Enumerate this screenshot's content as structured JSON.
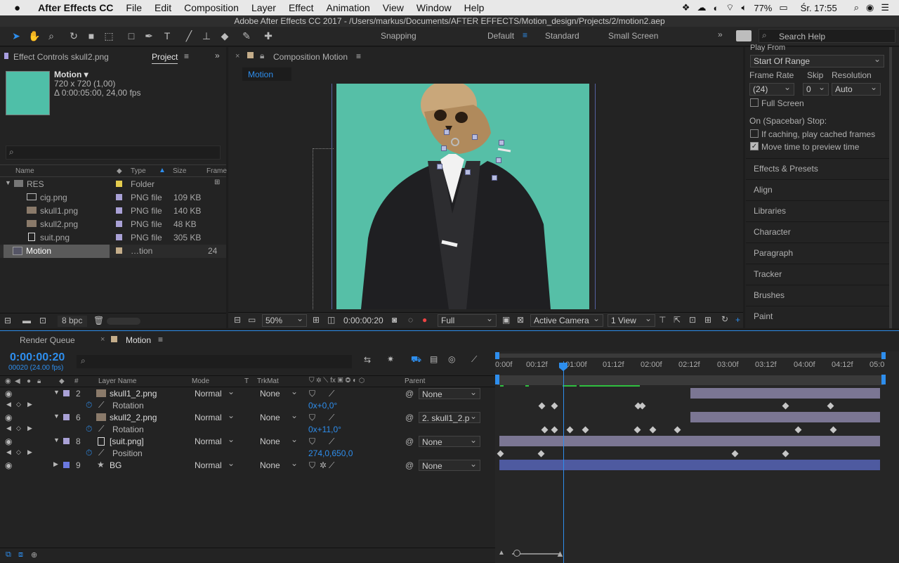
{
  "menubar": {
    "apple_icon": "apple-icon",
    "app": "After Effects CC",
    "items": [
      "File",
      "Edit",
      "Composition",
      "Layer",
      "Effect",
      "Animation",
      "View",
      "Window",
      "Help"
    ],
    "battery": "77%",
    "clock": "Śr. 17:55"
  },
  "window_title": "Adobe After Effects CC 2017 - /Users/markus/Documents/AFTER EFFECTS/Motion_design/Projects/2/motion2.aep",
  "toolbar": {
    "snapping": "Snapping",
    "workspaces": [
      "Default",
      "Standard",
      "Small Screen"
    ],
    "search_placeholder": "Search Help"
  },
  "project": {
    "tab_effect": "Effect Controls skull2.png",
    "tab_project": "Project",
    "thumb_color": "#4fbfa8",
    "comp_name": "Motion ▾",
    "comp_size": "720 x 720 (1,00)",
    "comp_dur": "Δ 0:00:05:00, 24,00 fps",
    "columns": [
      "Name",
      "Type",
      "Size",
      "Frame"
    ],
    "items": [
      {
        "name": "RES",
        "type": "Folder",
        "size": ""
      },
      {
        "name": "cig.png",
        "type": "PNG file",
        "size": "109 KB"
      },
      {
        "name": "skull1.png",
        "type": "PNG file",
        "size": "140 KB"
      },
      {
        "name": "skull2.png",
        "type": "PNG file",
        "size": "48 KB"
      },
      {
        "name": "suit.png",
        "type": "PNG file",
        "size": "305 KB"
      },
      {
        "name": "Motion",
        "type": "…tion",
        "size": "24"
      }
    ],
    "bpc": "8 bpc"
  },
  "composition": {
    "tab_prefix": "Composition",
    "tab_name": "Motion",
    "subtab": "Motion",
    "bg_color": "#56bfa7",
    "zoom": "50%",
    "timecode": "0:00:00:20",
    "resolution": "Full",
    "camera": "Active Camera",
    "views": "1 View"
  },
  "preview": {
    "play_from": "Play From",
    "play_from_value": "Start Of Range",
    "frame_rate_label": "Frame Rate",
    "skip_label": "Skip",
    "resolution_label": "Resolution",
    "frame_rate": "(24)",
    "skip": "0",
    "resolution": "Auto",
    "full_screen": "Full Screen",
    "on_stop": "On (Spacebar) Stop:",
    "if_caching": "If caching, play cached frames",
    "move_time": "Move time to preview time"
  },
  "right_panels": [
    "Effects & Presets",
    "Align",
    "Libraries",
    "Character",
    "Paragraph",
    "Tracker",
    "Brushes",
    "Paint"
  ],
  "timeline": {
    "tab_render": "Render Queue",
    "tab_motion": "Motion",
    "timecode": "0:00:00:20",
    "fps": "00020 (24.00 fps)",
    "col_headers": [
      "#",
      "Layer Name",
      "Mode",
      "T",
      "TrkMat",
      "Parent"
    ],
    "ruler": [
      "0:00f",
      "00:12f",
      "01:00f",
      "01:12f",
      "02:00f",
      "02:12f",
      "03:00f",
      "03:12f",
      "04:00f",
      "04:12f",
      "05:0"
    ],
    "layers": [
      {
        "num": "2",
        "name": "skull1_2.png",
        "mode": "Normal",
        "trkmat": "None",
        "parent": "None",
        "prop": "Rotation",
        "value": "0x+0,0°"
      },
      {
        "num": "6",
        "name": "skull2_2.png",
        "mode": "Normal",
        "trkmat": "None",
        "parent": "2. skull1_2.p",
        "prop": "Rotation",
        "value": "0x+11,0°"
      },
      {
        "num": "8",
        "name": "[suit.png]",
        "mode": "Normal",
        "trkmat": "None",
        "parent": "None",
        "prop": "Position",
        "value": "274,0,650,0"
      },
      {
        "num": "9",
        "name": "BG",
        "mode": "Normal",
        "trkmat": "None",
        "parent": "None"
      }
    ]
  }
}
